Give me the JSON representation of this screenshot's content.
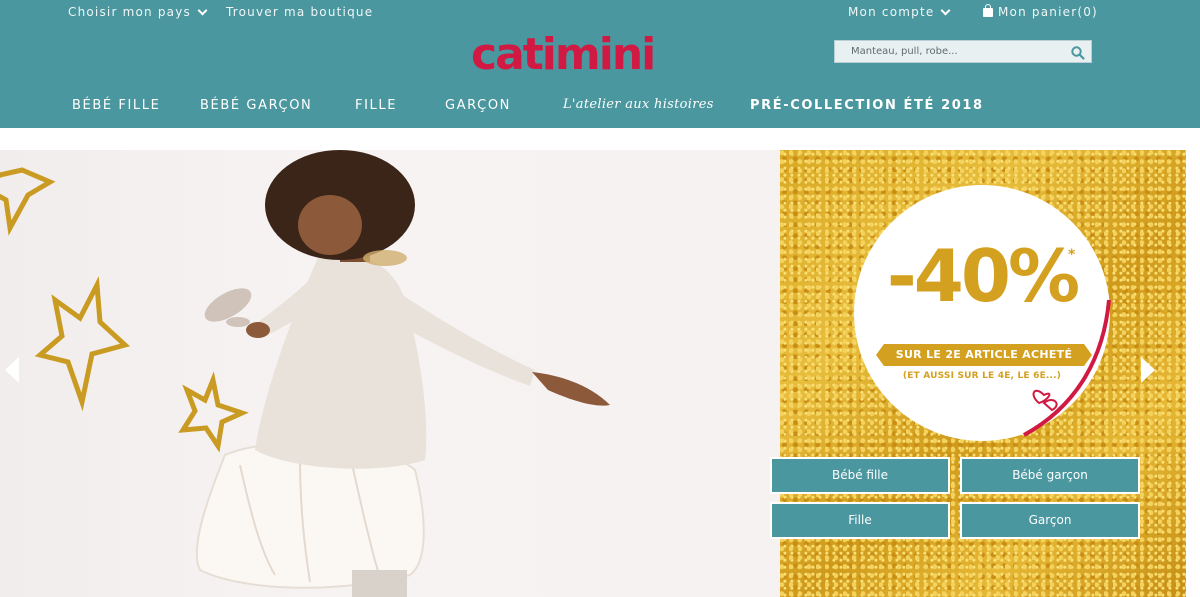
{
  "header": {
    "country_label": "Choisir mon pays",
    "store_label": "Trouver ma boutique",
    "account_label": "Mon compte",
    "cart_label": "Mon panier(0)",
    "logo_text": "catimini",
    "search": {
      "placeholder": "Manteau, pull, robe..."
    }
  },
  "nav": {
    "items": [
      {
        "label": "BÉBÉ FILLE"
      },
      {
        "label": "BÉBÉ GARÇON"
      },
      {
        "label": "FILLE"
      },
      {
        "label": "GARÇON"
      },
      {
        "label": "L'atelier aux histoires"
      },
      {
        "label": "PRÉ-COLLECTION ÉTÉ 2018"
      }
    ]
  },
  "promo": {
    "value": "-40%",
    "asterisk": "*",
    "line1": "SUR LE 2E ARTICLE ACHETÉ",
    "line2": "(ET AUSSI SUR LE 4E, LE 6E...)"
  },
  "categories": [
    {
      "label": "Bébé fille"
    },
    {
      "label": "Bébé garçon"
    },
    {
      "label": "Fille"
    },
    {
      "label": "Garçon"
    }
  ],
  "colors": {
    "header_bg": "#4a979f",
    "brand_red": "#d11a43",
    "gold": "#d4a020"
  },
  "icons": [
    "chevron-down-icon",
    "shopping-bag-icon",
    "search-icon",
    "arrow-left-icon",
    "arrow-right-icon"
  ]
}
